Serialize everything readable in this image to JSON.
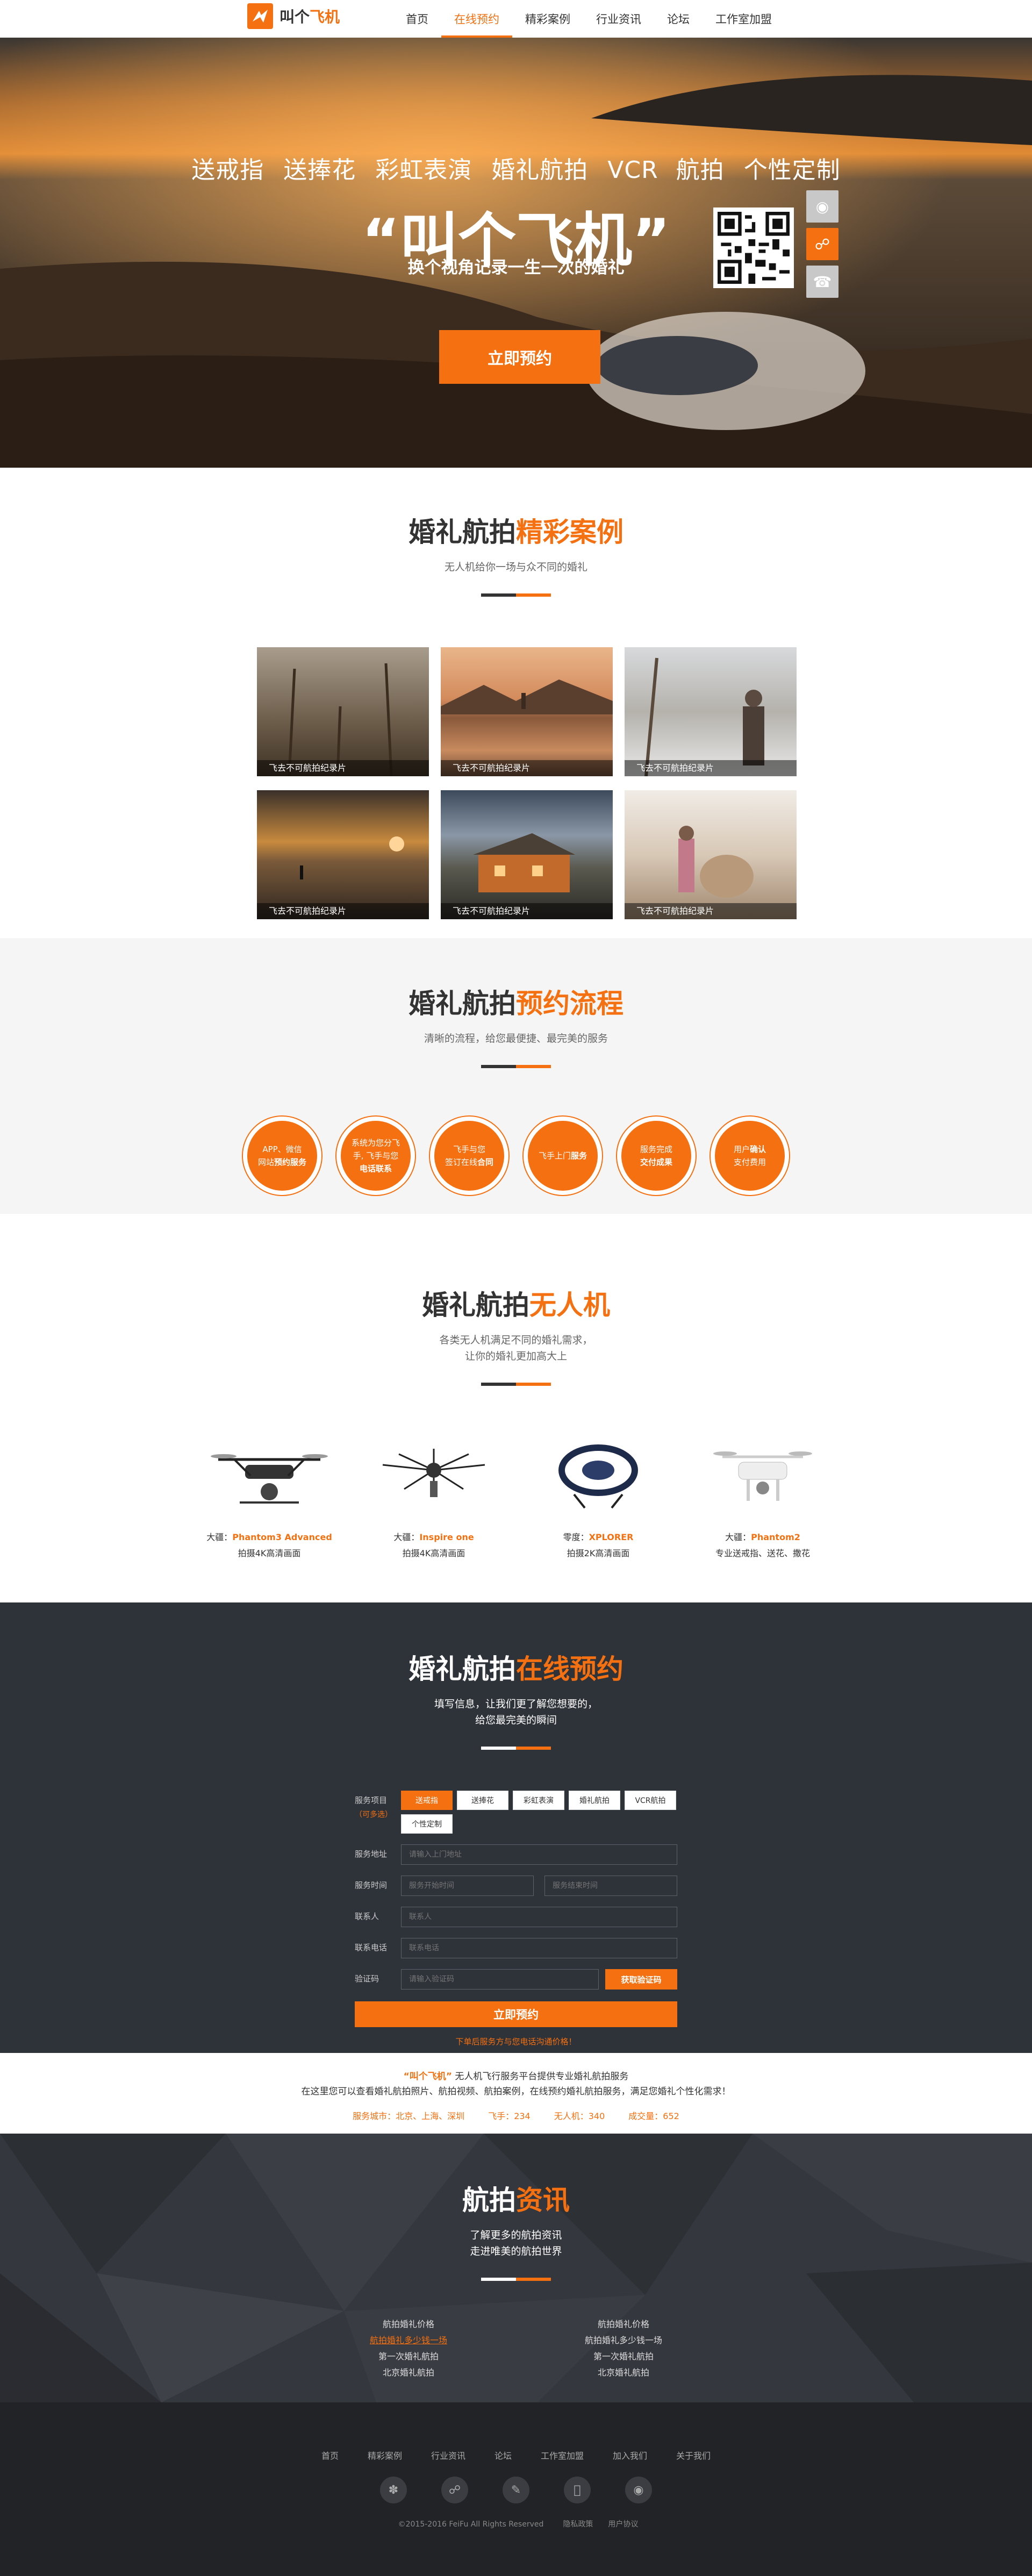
{
  "header": {
    "logo_text_a": "叫个",
    "logo_text_b": "飞机",
    "nav": [
      "首页",
      "在线预约",
      "精彩案例",
      "行业资讯",
      "论坛",
      "工作室加盟"
    ],
    "active_index": 1
  },
  "hero": {
    "services": [
      "送戒指",
      "送捧花",
      "彩虹表演",
      "婚礼航拍",
      "VCR 航拍",
      "个性定制"
    ],
    "title": "“叫个飞机”",
    "subtitle": "换个视角记录一生一次的婚礼",
    "button": "立即预约",
    "side_icons": [
      "android-icon",
      "wechat-icon",
      "phone-icon"
    ]
  },
  "cases": {
    "title_a": "婚礼航拍",
    "title_b": "精彩案例",
    "subtitle": "无人机给你一场与众不同的婚礼",
    "items": [
      {
        "caption": "飞去不可航拍纪录片"
      },
      {
        "caption": "飞去不可航拍纪录片"
      },
      {
        "caption": "飞去不可航拍纪录片"
      },
      {
        "caption": "飞去不可航拍纪录片"
      },
      {
        "caption": "飞去不可航拍纪录片"
      },
      {
        "caption": "飞去不可航拍纪录片"
      }
    ]
  },
  "flow": {
    "title_a": "婚礼航拍",
    "title_b": "预约流程",
    "subtitle": "清晰的流程，给您最便捷、最完美的服务",
    "steps": [
      {
        "l1": "APP、微信",
        "l2": "网站",
        "l3": "预约服务"
      },
      {
        "l1": "系统为您分飞",
        "l2": "手, 飞手与您",
        "l3": "电话联系"
      },
      {
        "l1": "飞手与您",
        "l2": "签订在线",
        "l3": "合同"
      },
      {
        "l1": "飞手上门",
        "l2": "",
        "l3": "服务"
      },
      {
        "l1": "服务完成",
        "l2": "",
        "l3": "交付成果"
      },
      {
        "l1": "用户",
        "l2": "确认",
        "l3": "支付费用"
      }
    ]
  },
  "drones": {
    "title_a": "婚礼航拍",
    "title_b": "无人机",
    "subtitle_1": "各类无人机满足不同的婚礼需求，",
    "subtitle_2": "让你的婚礼更加高大上",
    "items": [
      {
        "prefix": "大疆：",
        "name": "Phantom3 Advanced",
        "desc": "拍摄4K高清画面"
      },
      {
        "prefix": "大疆：",
        "name": "Inspire one",
        "desc": "拍摄4K高清画面"
      },
      {
        "prefix": "零度：",
        "name": "XPLORER",
        "desc": "拍摄2K高清画面"
      },
      {
        "prefix": "大疆：",
        "name": "Phantom2",
        "desc": "专业送戒指、送花、撒花"
      }
    ]
  },
  "booking": {
    "title_a": "婚礼航拍",
    "title_b": "在线预约",
    "subtitle_1": "填写信息，让我们更了解您想要的，",
    "subtitle_2": "给您最完美的瞬间",
    "service_label": "服务项目",
    "service_hint": "（可多选）",
    "options": [
      "送戒指",
      "送捧花",
      "彩虹表演",
      "婚礼航拍",
      "VCR航拍",
      "个性定制"
    ],
    "selected_option": 0,
    "address_label": "服务地址",
    "address_placeholder": "请输入上门地址",
    "time_label": "服务时间",
    "time_start_placeholder": "服务开始时间",
    "time_end_placeholder": "服务结束时间",
    "contact_label": "联系人",
    "contact_placeholder": "联系人",
    "phone_label": "联系电话",
    "phone_placeholder": "联系电话",
    "code_label": "验证码",
    "code_placeholder": "请输入验证码",
    "code_button": "获取验证码",
    "submit": "立即预约",
    "note": "下单后服务方与您电话沟通价格！"
  },
  "intro": {
    "brand": "“叫个飞机”",
    "line1_rest": "无人机飞行服务平台提供专业婚礼航拍服务",
    "line2": "在这里您可以查看婚礼航拍照片、航拍视频、航拍案例，在线预约婚礼航拍服务，满足您婚礼个性化需求！",
    "stats": [
      "服务城市：北京、上海、深圳",
      "飞手：234",
      "无人机：340",
      "成交量：652"
    ]
  },
  "news": {
    "title_a": "航拍",
    "title_b": "资讯",
    "subtitle_1": "了解更多的航拍资讯",
    "subtitle_2": "走进唯美的航拍世界",
    "left": [
      "航拍婚礼价格",
      "航拍婚礼多少钱一场",
      "第一次婚礼航拍",
      "北京婚礼航拍"
    ],
    "right": [
      "航拍婚礼价格",
      "航拍婚礼多少钱一场",
      "第一次婚礼航拍",
      "北京婚礼航拍"
    ],
    "hot_index": 1
  },
  "footer": {
    "links": [
      "首页",
      "精彩案例",
      "行业资讯",
      "论坛",
      "工作室加盟",
      "加入我们",
      "关于我们"
    ],
    "icons": [
      "weibo-icon",
      "wechat-icon",
      "tieba-icon",
      "apple-icon",
      "android-icon"
    ],
    "copyright": "©2015-2016 FeiFu All Rights Reserved",
    "privacy": "隐私政策",
    "agreement": "用户协议"
  },
  "colors": {
    "accent": "#f57010",
    "dark": "#2e3239",
    "footer": "#222326"
  }
}
